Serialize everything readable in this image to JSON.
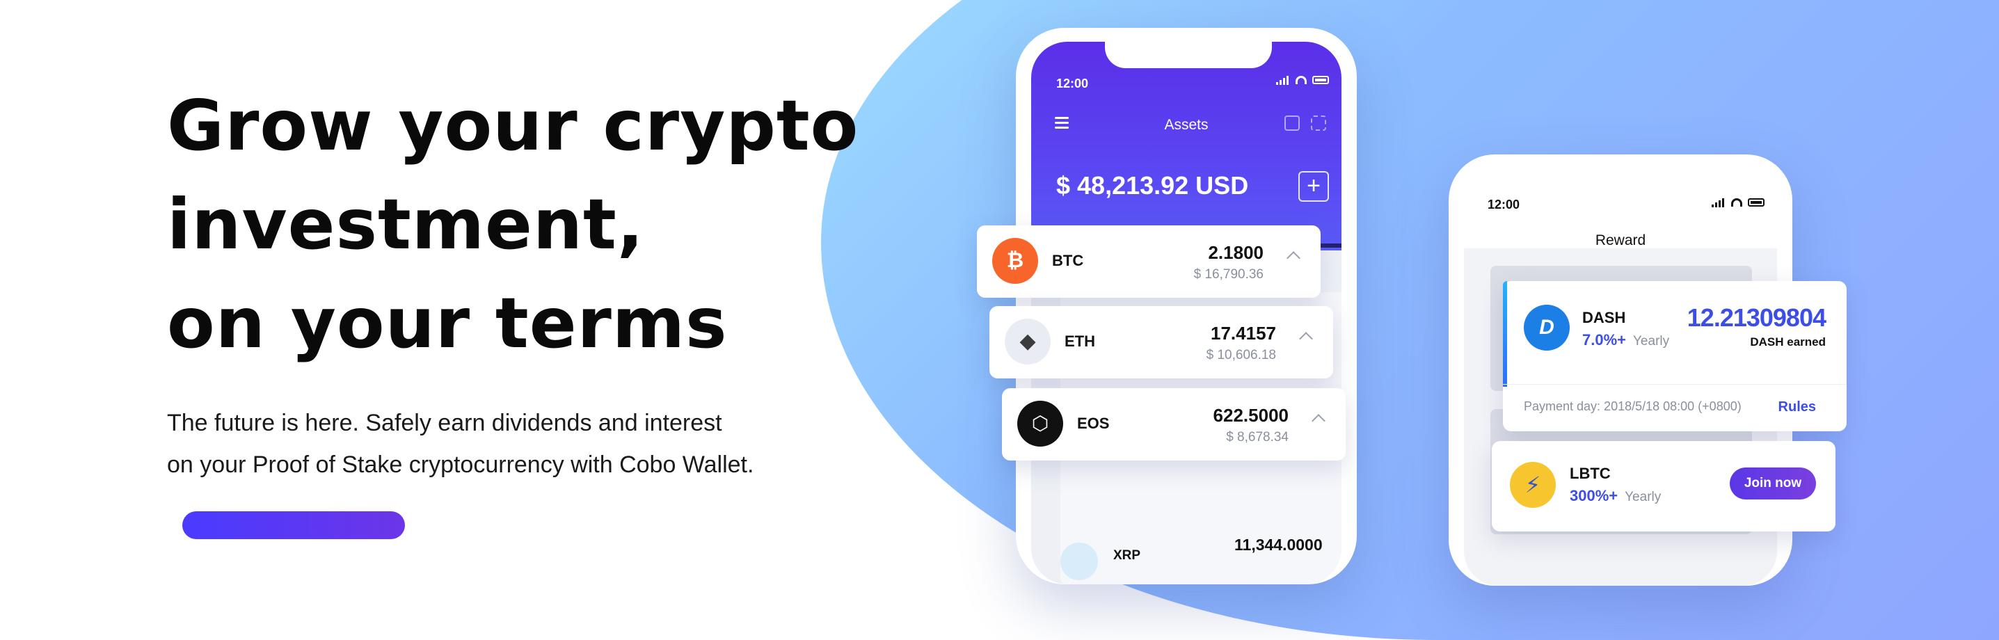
{
  "hero": {
    "title_lines": [
      "Grow your crypto",
      "investment,",
      "on your terms"
    ],
    "subtitle_lines": [
      "The future is here. Safely earn dividends and interest",
      "on your Proof of Stake cryptocurrency with Cobo Wallet."
    ]
  },
  "colors": {
    "brand_gradient_start": "#5b2fe8",
    "brand_gradient_end": "#5a5bf6",
    "accent_blue": "#3d4ee6",
    "btc": "#f7652a",
    "eth": "#e9ecf2",
    "eos": "#111111",
    "dash": "#1b7fe6",
    "lbtc": "#f7c62e"
  },
  "phone_assets": {
    "time": "12:00",
    "title": "Assets",
    "balance": "$ 48,213.92 USD",
    "add_label": "+",
    "coins": [
      {
        "symbol": "BTC",
        "amount": "2.1800",
        "usd": "$ 16,790.36",
        "icon": "bitcoin-icon"
      },
      {
        "symbol": "ETH",
        "amount": "17.4157",
        "usd": "$ 10,606.18",
        "icon": "ethereum-icon"
      },
      {
        "symbol": "EOS",
        "amount": "622.5000",
        "usd": "$ 8,678.34",
        "icon": "eos-icon"
      },
      {
        "symbol": "XRP",
        "amount": "11,344.0000",
        "usd": "",
        "icon": "ripple-icon"
      }
    ]
  },
  "phone_reward": {
    "time": "12:00",
    "title": "Reward",
    "dash": {
      "name": "DASH",
      "rate": "7.0%+",
      "rate_label": "Yearly",
      "earned": "12.21309804",
      "earned_label": "DASH earned",
      "payment_day": "Payment day: 2018/5/18 08:00 (+0800)",
      "rules_label": "Rules"
    },
    "lbtc": {
      "name": "LBTC",
      "rate": "300%+",
      "rate_label": "Yearly",
      "join_label": "Join now"
    }
  }
}
